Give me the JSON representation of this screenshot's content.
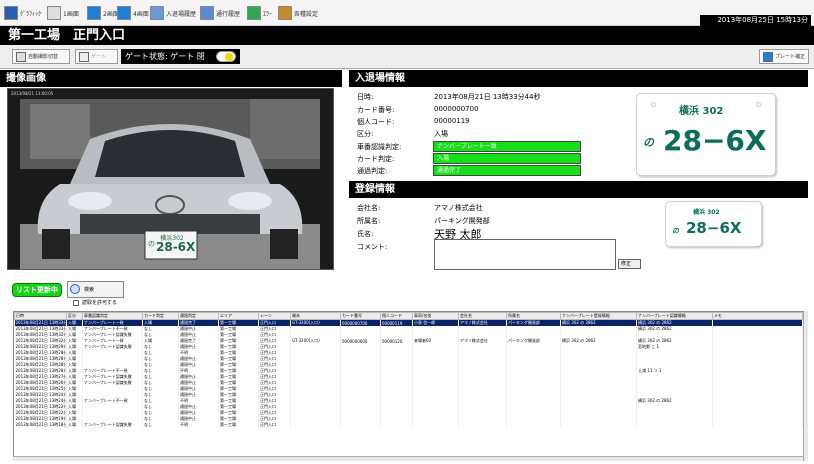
{
  "menubar": {
    "items": [
      {
        "label": "ｸﾞﾗﾌｨｯｸ",
        "icon": "blue-grid-icon"
      },
      {
        "label": "1画面",
        "icon": "single-view-icon"
      },
      {
        "label": "2画面",
        "icon": "dual-view-icon"
      },
      {
        "label": "4画面",
        "icon": "quad-view-icon"
      },
      {
        "label": "入退場履歴",
        "icon": "car-history-icon"
      },
      {
        "label": "通行履歴",
        "icon": "people-history-icon"
      },
      {
        "label": "ｴﾗｰ",
        "icon": "error-icon"
      },
      {
        "label": "各種設定",
        "icon": "settings-icon"
      }
    ],
    "clock": "2013年08月25日 15時13分"
  },
  "title": "第一工場　正門入口",
  "toolbar": {
    "btn_camera_all": "自動撮影切替",
    "btn_gate": "ゲート",
    "gate_status": "ゲート状態:  ゲート 閉",
    "btn_plate_fix": "プレート補正"
  },
  "camera": {
    "header": "撮像画像",
    "timestamp": "2013/08/21 13:00:05",
    "plate_top": "横浜302",
    "plate_main": "28-6X",
    "plate_kana": "の"
  },
  "entry": {
    "header": "入退場情報",
    "rows": [
      {
        "label": "日時:",
        "value": "2013年08月21日 13時33分44秒"
      },
      {
        "label": "カード番号:",
        "value": "0000000700"
      },
      {
        "label": "個人コード:",
        "value": "00000119"
      },
      {
        "label": "区分:",
        "value": "入場"
      },
      {
        "label": "車番認識判定:",
        "value": "ナンバープレート一致"
      },
      {
        "label": "カード判定:",
        "value": "入場"
      },
      {
        "label": "通過判定:",
        "value": "通過完了"
      }
    ],
    "plate": {
      "region": "横浜 302",
      "kana": "の",
      "number": "28−6X"
    }
  },
  "registration": {
    "header": "登録情報",
    "company_label": "会社名:",
    "company": "アマノ株式会社",
    "dept_label": "所属名:",
    "dept": "パーキング開発部",
    "name_label": "氏名:",
    "name": "天野  太郎",
    "comment_label": "コメント:",
    "correct_btn": "修正",
    "plate": {
      "region": "横浜 302",
      "kana": "の",
      "number": "28−6X"
    }
  },
  "list": {
    "update_btn": "リスト更新中",
    "search_btn": "検索",
    "checkbox_label": "読取を許可する",
    "columns": [
      "日時",
      "区分",
      "車番認識判定",
      "カード判定",
      "通過判定",
      "エリア",
      "レーン",
      "端末",
      "カード番号",
      "個人コード",
      "車両/名前",
      "会社名",
      "所属名",
      "ナンバープレート登録情報",
      "ナンバープレート認識情報",
      "メモ"
    ],
    "rows": [
      [
        "2013年08月21日 13時33分44秒",
        "入場",
        "ナンバープレート一致",
        "入場",
        "通過完了",
        "第一工場",
        "正門入口",
        "GT-3200(入口)",
        "0000000700",
        "00000119",
        "小泉 信一郎",
        "アマノ株式会社",
        "パーキング開発部",
        "横浜 302 の 2862",
        "横浜 302 の 2862",
        ""
      ],
      [
        "2013年08月21日 13時33分04秒",
        "入場",
        "ナンバープレート不一致",
        "なし",
        "通過中止",
        "第一工場",
        "正門入口",
        "",
        "",
        "",
        "",
        "",
        "",
        "",
        "横浜 302 の 2862",
        ""
      ],
      [
        "2013年08月21日 13時32分40秒",
        "入場",
        "ナンバープレート認識失敗",
        "なし",
        "通過中止",
        "第一工場",
        "正門入口",
        "",
        "",
        "",
        "",
        "",
        "",
        "",
        "",
        ""
      ],
      [
        "2013年08月21日 13時32分40秒",
        "入場",
        "ナンバープレート一致",
        "入場",
        "通過完了",
        "第一工場",
        "正門入口",
        "GT-3200(入口)",
        "0000000600",
        "00000120",
        "来場者60",
        "アマノ株式会社",
        "パーキング開発部",
        "横浜 302 の 2862",
        "横浜 302 の 2862",
        ""
      ],
      [
        "2013年08月21日 13時29分48秒",
        "入場",
        "ナンバープレート認識失敗",
        "なし",
        "通過中止",
        "第一工場",
        "正門入口",
        "",
        "",
        "",
        "",
        "",
        "",
        "",
        "宮地野 こ 1",
        ""
      ],
      [
        "2013年08月21日 13時28分38秒",
        "入場",
        "",
        "なし",
        "不明",
        "第一工場",
        "正門入口",
        "",
        "",
        "",
        "",
        "",
        "",
        "",
        "",
        ""
      ],
      [
        "2013年08月21日 13時28分35秒",
        "入場",
        "",
        "なし",
        "通過中止",
        "第一工場",
        "正門入口",
        "",
        "",
        "",
        "",
        "",
        "",
        "",
        "",
        ""
      ],
      [
        "2013年08月21日 13時28分22秒",
        "入場",
        "",
        "なし",
        "通過中止",
        "第一工場",
        "正門入口",
        "",
        "",
        "",
        "",
        "",
        "",
        "",
        "",
        ""
      ],
      [
        "2013年08月21日 13時28分02秒",
        "入場",
        "ナンバープレート不一致",
        "なし",
        "不明",
        "第一工場",
        "正門入口",
        "",
        "",
        "",
        "",
        "",
        "",
        "",
        "土浦 11 つ 1",
        ""
      ],
      [
        "2013年08月21日 13時27分57秒",
        "入場",
        "ナンバープレート認識失敗",
        "なし",
        "通過中止",
        "第一工場",
        "正門入口",
        "",
        "",
        "",
        "",
        "",
        "",
        "",
        "",
        ""
      ],
      [
        "2013年08月21日 13時26分25秒",
        "入場",
        "ナンバープレート認識失敗",
        "なし",
        "通過中止",
        "第一工場",
        "正門入口",
        "",
        "",
        "",
        "",
        "",
        "",
        "",
        "",
        ""
      ],
      [
        "2013年08月21日 13時25分33秒",
        "入場",
        "",
        "なし",
        "通過中止",
        "第一工場",
        "正門入口",
        "",
        "",
        "",
        "",
        "",
        "",
        "",
        "",
        ""
      ],
      [
        "2013年08月21日 13時24分39秒",
        "入場",
        "",
        "なし",
        "通過中止",
        "第一工場",
        "正門入口",
        "",
        "",
        "",
        "",
        "",
        "",
        "",
        "",
        ""
      ],
      [
        "2013年08月21日 13時24分26秒",
        "入場",
        "ナンバープレート不一致",
        "なし",
        "不明",
        "第一工場",
        "正門入口",
        "",
        "",
        "",
        "",
        "",
        "",
        "",
        "横浜 302 の 2862",
        ""
      ],
      [
        "2013年08月21日 13時22分33秒",
        "入場",
        "",
        "なし",
        "通過中止",
        "第一工場",
        "正門入口",
        "",
        "",
        "",
        "",
        "",
        "",
        "",
        "",
        ""
      ],
      [
        "2013年08月21日 13時22分11秒",
        "入場",
        "",
        "なし",
        "通過中止",
        "第一工場",
        "正門入口",
        "",
        "",
        "",
        "",
        "",
        "",
        "",
        "",
        ""
      ],
      [
        "2013年08月21日 13時19分52秒",
        "入場",
        "",
        "なし",
        "通過中止",
        "第一工場",
        "正門入口",
        "",
        "",
        "",
        "",
        "",
        "",
        "",
        "",
        ""
      ],
      [
        "2013年08月21日 13時18分21秒",
        "入場",
        "ナンバープレート認識失敗",
        "なし",
        "不明",
        "第一工場",
        "正門入口",
        "",
        "",
        "",
        "",
        "",
        "",
        "",
        "",
        ""
      ]
    ]
  }
}
